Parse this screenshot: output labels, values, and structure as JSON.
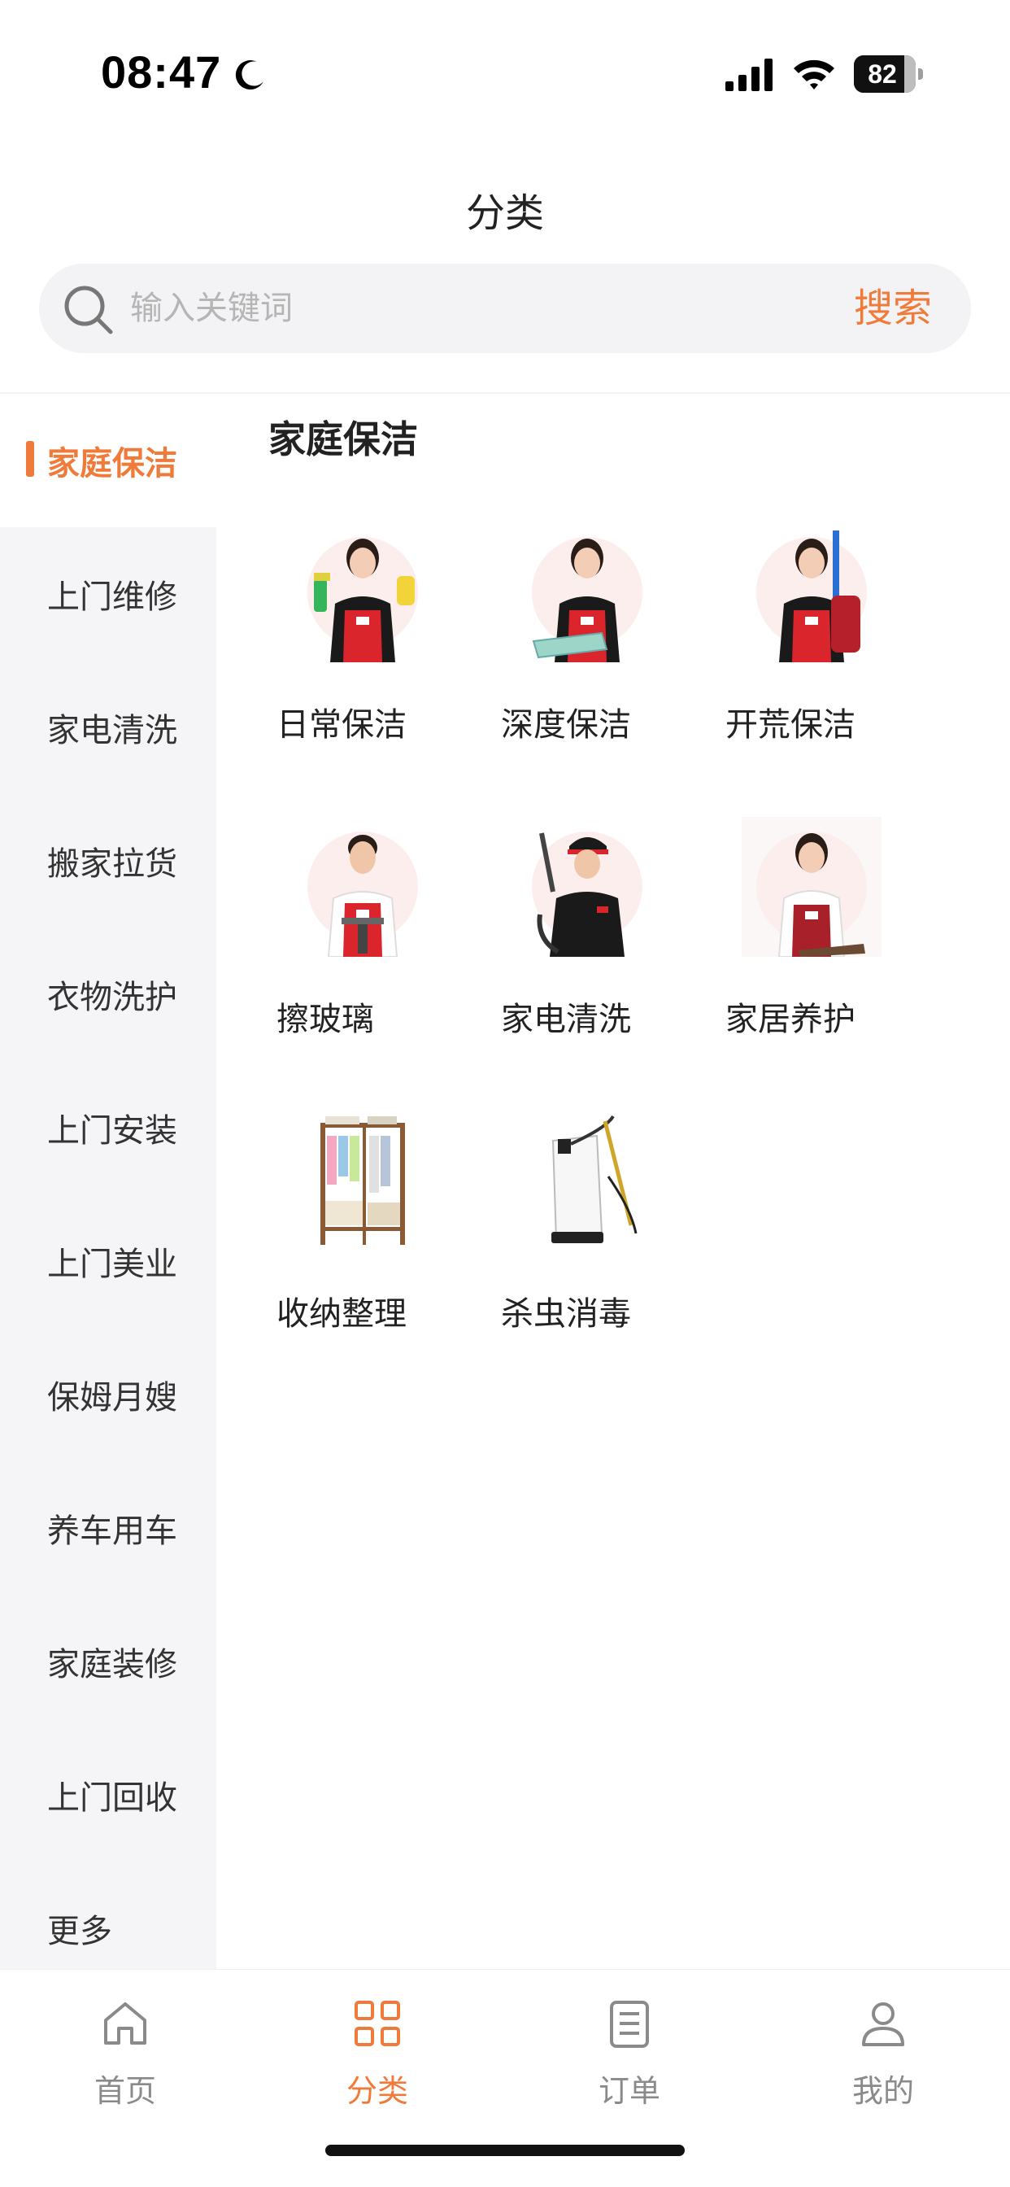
{
  "status_bar": {
    "time": "08:47",
    "battery": "82",
    "battery_level": 0.82
  },
  "header": {
    "title": "分类"
  },
  "search": {
    "placeholder": "输入关键词",
    "value": "",
    "button_label": "搜索"
  },
  "sidebar": {
    "active_index": 0,
    "items": [
      {
        "label": "家庭保洁"
      },
      {
        "label": "上门维修"
      },
      {
        "label": "家电清洗"
      },
      {
        "label": "搬家拉货"
      },
      {
        "label": "衣物洗护"
      },
      {
        "label": "上门安装"
      },
      {
        "label": "上门美业"
      },
      {
        "label": "保姆月嫂"
      },
      {
        "label": "养车用车"
      },
      {
        "label": "家庭装修"
      },
      {
        "label": "上门回收"
      },
      {
        "label": "更多"
      }
    ]
  },
  "content": {
    "section_title": "家庭保洁",
    "services": [
      {
        "label": "日常保洁",
        "icon": "cleaner-with-spray-icon"
      },
      {
        "label": "深度保洁",
        "icon": "cleaner-with-tray-icon"
      },
      {
        "label": "开荒保洁",
        "icon": "cleaner-with-backpack-icon"
      },
      {
        "label": "擦玻璃",
        "icon": "window-cleaner-icon"
      },
      {
        "label": "家电清洗",
        "icon": "appliance-cleaner-icon"
      },
      {
        "label": "家居养护",
        "icon": "furniture-care-icon"
      },
      {
        "label": "收纳整理",
        "icon": "wardrobe-rack-icon"
      },
      {
        "label": "杀虫消毒",
        "icon": "sprayer-tank-icon"
      }
    ]
  },
  "tab_bar": {
    "active_index": 1,
    "tabs": [
      {
        "label": "首页",
        "icon": "home-icon"
      },
      {
        "label": "分类",
        "icon": "grid-icon"
      },
      {
        "label": "订单",
        "icon": "order-list-icon"
      },
      {
        "label": "我的",
        "icon": "user-icon"
      }
    ]
  },
  "colors": {
    "accent": "#f07a3a",
    "sidebar_bg": "#f5f5f7",
    "apron_red": "#d9252b"
  }
}
